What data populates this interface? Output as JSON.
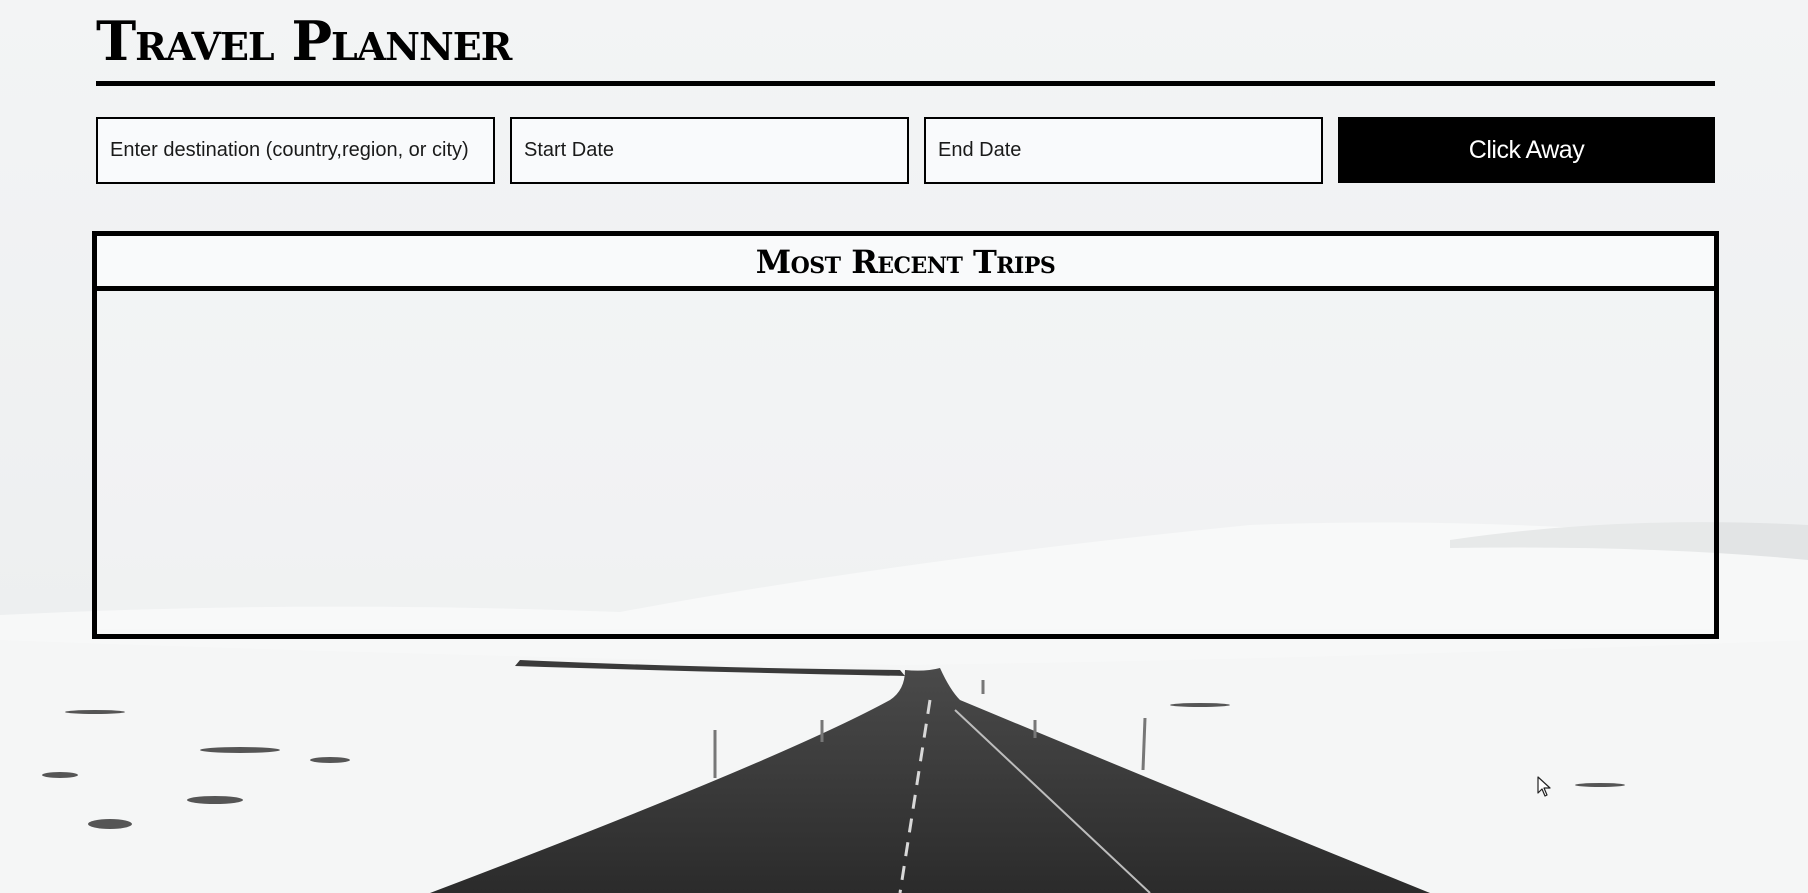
{
  "app": {
    "title": "Travel Planner"
  },
  "search": {
    "destination_placeholder": "Enter destination (country,region, or city)",
    "start_placeholder": "Start Date",
    "end_placeholder": "End Date",
    "submit_label": "Click Away"
  },
  "recent_trips": {
    "title": "Most Recent Trips",
    "items": []
  },
  "colors": {
    "primary": "#000000",
    "button_text": "#ffffff",
    "background_sky": "#f4f5f5"
  },
  "icons": {
    "cursor": "mouse-pointer-icon"
  }
}
